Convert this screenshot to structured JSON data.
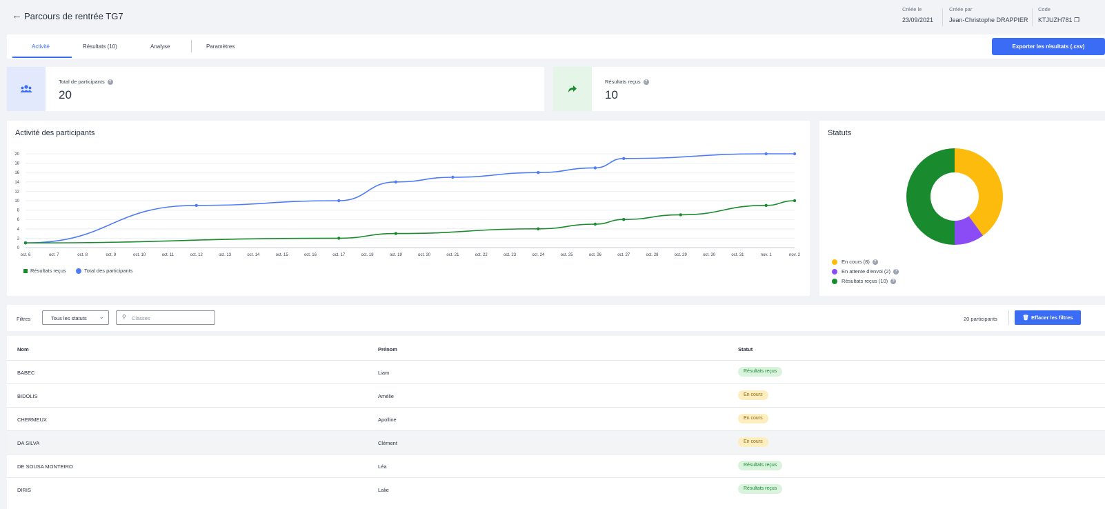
{
  "header": {
    "back_icon": "arrow-left-icon",
    "title": "Parcours de rentrée TG7",
    "created_label": "Créée le",
    "created_value": "23/09/2021",
    "author_label": "Créée par",
    "author_value": "Jean-Christophe DRAPPIER",
    "code_label": "Code",
    "code_value": "KTJUZH781"
  },
  "tabs": [
    {
      "label": "Activité",
      "active": true
    },
    {
      "label": "Résultats (10)",
      "active": false
    },
    {
      "label": "Analyse",
      "active": false
    },
    {
      "label": "Paramètres",
      "active": false
    }
  ],
  "export_label": "Exporter les résultats (.csv)",
  "stats": {
    "participants": {
      "label": "Total de participants",
      "value": "20",
      "icon": "users-icon"
    },
    "results": {
      "label": "Résultats reçus",
      "value": "10",
      "icon": "share-arrow-icon"
    }
  },
  "activity_chart": {
    "title": "Activité des participants",
    "legend": [
      "Résultats reçus",
      "Total des participants"
    ]
  },
  "statuts": {
    "title": "Statuts",
    "legend": [
      "En cours (8)",
      "En attente d'envoi (2)",
      "Résultats reçus (10)"
    ]
  },
  "colors": {
    "accent": "#3b6cf6",
    "total_line": "#4f7cf5",
    "results_line": "#1a8a2e",
    "en_cours": "#fdbb0e",
    "en_attente": "#8b4cf5",
    "recus": "#1a8a2e"
  },
  "chart_data": [
    {
      "type": "line",
      "x": [
        "oct. 6",
        "oct. 7",
        "oct. 8",
        "oct. 9",
        "oct. 10",
        "oct. 11",
        "oct. 12",
        "oct. 13",
        "oct. 14",
        "oct. 15",
        "oct. 16",
        "oct. 17",
        "oct. 18",
        "oct. 19",
        "oct. 20",
        "oct. 21",
        "oct. 22",
        "oct. 23",
        "oct. 24",
        "oct. 25",
        "oct. 26",
        "oct. 27",
        "oct. 28",
        "oct. 29",
        "oct. 30",
        "oct. 31",
        "nov. 1",
        "nov. 2"
      ],
      "yticks": [
        0,
        2,
        4,
        6,
        8,
        10,
        12,
        14,
        16,
        18,
        20
      ],
      "ylim": [
        0,
        20
      ],
      "series": [
        {
          "name": "Total des participants",
          "points": [
            [
              "oct. 6",
              1
            ],
            [
              "oct. 12",
              9
            ],
            [
              "oct. 17",
              10
            ],
            [
              "oct. 19",
              14
            ],
            [
              "oct. 21",
              15
            ],
            [
              "oct. 24",
              16
            ],
            [
              "oct. 26",
              17
            ],
            [
              "oct. 27",
              19
            ],
            [
              "nov. 1",
              20
            ],
            [
              "nov. 2",
              20
            ]
          ]
        },
        {
          "name": "Résultats reçus",
          "points": [
            [
              "oct. 6",
              1
            ],
            [
              "oct. 17",
              2
            ],
            [
              "oct. 19",
              3
            ],
            [
              "oct. 24",
              4
            ],
            [
              "oct. 26",
              5
            ],
            [
              "oct. 27",
              6
            ],
            [
              "oct. 29",
              7
            ],
            [
              "nov. 1",
              9
            ],
            [
              "nov. 2",
              10
            ]
          ]
        }
      ],
      "grid": true,
      "legend": "bottom-left"
    },
    {
      "type": "pie",
      "donut": true,
      "slices": [
        {
          "name": "En cours",
          "value": 8
        },
        {
          "name": "En attente d'envoi",
          "value": 2
        },
        {
          "name": "Résultats reçus",
          "value": 10
        }
      ]
    }
  ],
  "filters": {
    "label": "Filtres",
    "status_select": "Tous les statuts",
    "search_placeholder": "Classes",
    "count": "20 participants",
    "clear_label": "Effacer les filtres"
  },
  "table": {
    "columns": [
      "Nom",
      "Prénom",
      "Statut"
    ],
    "rows": [
      {
        "nom": "BABEC",
        "prenom": "Liam",
        "statut": "Résultats reçus",
        "kind": "green"
      },
      {
        "nom": "BIDOLIS",
        "prenom": "Amélie",
        "statut": "En cours",
        "kind": "yellow"
      },
      {
        "nom": "CHERMEUX",
        "prenom": "Apolline",
        "statut": "En cours",
        "kind": "yellow"
      },
      {
        "nom": "DA SILVA",
        "prenom": "Clément",
        "statut": "En cours",
        "kind": "yellow"
      },
      {
        "nom": "DE SOUSA MONTEIRO",
        "prenom": "Léa",
        "statut": "Résultats reçus",
        "kind": "green"
      },
      {
        "nom": "DIRIS",
        "prenom": "Lalie",
        "statut": "Résultats reçus",
        "kind": "green"
      }
    ]
  }
}
